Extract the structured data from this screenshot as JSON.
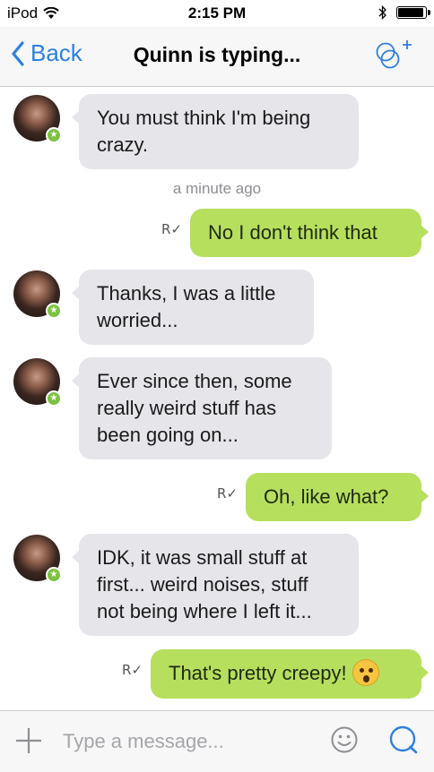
{
  "status_bar": {
    "carrier": "iPod",
    "time": "2:15 PM",
    "battery_level": 0.95,
    "icons": [
      "wifi-icon",
      "bluetooth-icon",
      "battery-icon"
    ]
  },
  "nav": {
    "back_label": "Back",
    "title": "Quinn is typing...",
    "group_icon": "group-chat-plus-icon"
  },
  "messages": [
    {
      "direction": "in",
      "text": "You must think I'm being crazy."
    },
    {
      "type": "timestamp",
      "text": "a minute ago"
    },
    {
      "direction": "out",
      "text": "No I don't think that",
      "read_receipt": "R"
    },
    {
      "direction": "in",
      "text": "Thanks, I was a little worried..."
    },
    {
      "direction": "in",
      "text": "Ever since then, some really weird stuff has been going on..."
    },
    {
      "direction": "out",
      "text": "Oh, like what?",
      "read_receipt": "R"
    },
    {
      "direction": "in",
      "text": "IDK, it was small stuff at first... weird noises, stuff not being where I left it..."
    },
    {
      "direction": "out",
      "text": "That's pretty creepy!",
      "emoji": "astonished-face-emoji",
      "read_receipt": "R"
    }
  ],
  "input": {
    "placeholder": "Type a message...",
    "value": ""
  },
  "colors": {
    "accent": "#2d7fe0",
    "outgoing_bubble": "#b6df5e",
    "incoming_bubble": "#e5e5ea",
    "online_badge": "#7cc242"
  }
}
